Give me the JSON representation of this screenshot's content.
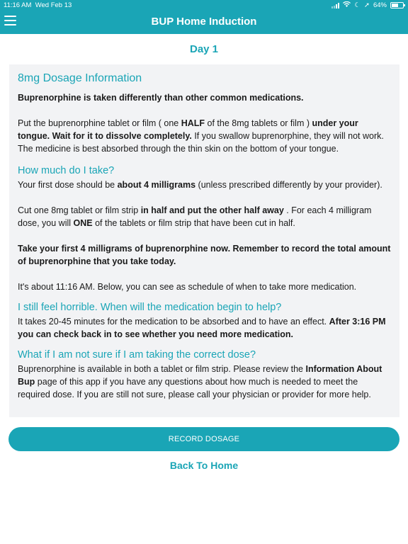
{
  "status_bar": {
    "time": "11:16 AM",
    "date": "Wed Feb 13",
    "battery": "64%"
  },
  "header": {
    "title": "BUP Home Induction",
    "menu_icon": "hamburger-menu-icon"
  },
  "day_label": "Day 1",
  "card": {
    "heading": "8mg Dosage Information",
    "intro_bold": "Buprenorphine is taken differently than other common medications.",
    "p1": {
      "t1": "Put the buprenorphine tablet or film ( one ",
      "b1": "HALF",
      "t2": " of the 8mg tablets or film ) ",
      "b2": "under your tongue. Wait for it to dissolve completely.",
      "t3": " If you swallow buprenorphine, they will not work. The medicine is best absorbed through the thin skin on the bottom of your tongue."
    },
    "section_how_much": {
      "heading": "How much do I take?",
      "p1_t1": "Your first dose should be ",
      "p1_b1": "about 4 milligrams",
      "p1_t2": " (unless prescribed differently by your provider).",
      "p2_t1": "Cut one 8mg tablet or film strip ",
      "p2_b1": "in half and put the other half away",
      "p2_t2": " . For each 4 milligram dose, you will ",
      "p2_b2": "ONE",
      "p2_t3": " of the tablets or film strip that have been cut in half.",
      "p3_bold": "Take your first 4 milligrams of buprenorphine now.   Remember to record the total amount of buprenorphine that you take today.",
      "p4": "It's about 11:16 AM. Below, you can see as schedule of when to take more medication."
    },
    "section_horrible": {
      "heading": "I still feel horrible. When will the medication begin to help?",
      "t1": "It takes 20-45 minutes for the medication to be absorbed and to have an effect.  ",
      "b1": "After 3:16 PM you can check back in to see whether you need more medication."
    },
    "section_not_sure": {
      "heading": "What if I am not sure if I am taking the correct dose?",
      "t1": "Buprenorphine is available in both a tablet or film strip.  Please review the ",
      "b1": "Information About Bup",
      "t2": " page of this app if you have any questions about how much is needed to meet the required dose.   If you are still not sure, please call your physician or provider for more help."
    }
  },
  "actions": {
    "record_label": "RECORD DOSAGE",
    "back_label": "Back To Home"
  },
  "colors": {
    "accent": "#1aa5b6",
    "card_bg": "#f2f3f5",
    "text": "#1a1a1a"
  }
}
